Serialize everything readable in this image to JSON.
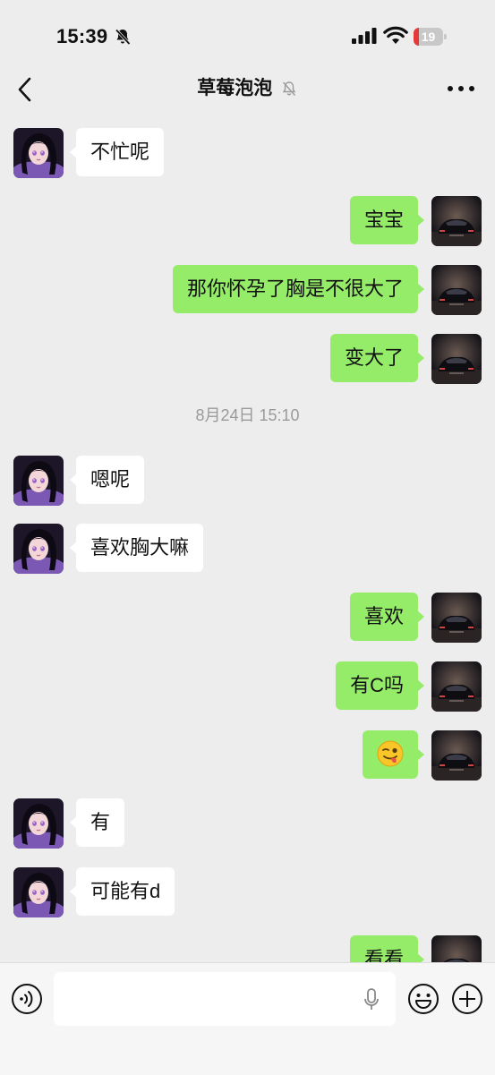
{
  "status_bar": {
    "time": "15:39",
    "battery": "19",
    "battery_level": 0.19
  },
  "nav": {
    "title": "草莓泡泡"
  },
  "colors": {
    "sent_bubble": "#95ec69",
    "received_bubble": "#ffffff",
    "background": "#ededed"
  },
  "messages": [
    {
      "side": "left",
      "text": "不忙呢"
    },
    {
      "side": "right",
      "text": "宝宝"
    },
    {
      "side": "right",
      "text": "那你怀孕了胸是不很大了"
    },
    {
      "side": "right",
      "text": "变大了"
    },
    {
      "timestamp": "8月24日 15:10"
    },
    {
      "side": "left",
      "text": "嗯呢"
    },
    {
      "side": "left",
      "text": "喜欢胸大嘛"
    },
    {
      "side": "right",
      "text": "喜欢"
    },
    {
      "side": "right",
      "text": "有C吗"
    },
    {
      "side": "right",
      "emoji": "winking-face-with-tongue"
    },
    {
      "side": "left",
      "text": "有"
    },
    {
      "side": "left",
      "text": "可能有d"
    },
    {
      "side": "right",
      "text": "看看"
    }
  ],
  "input": {
    "placeholder": ""
  }
}
